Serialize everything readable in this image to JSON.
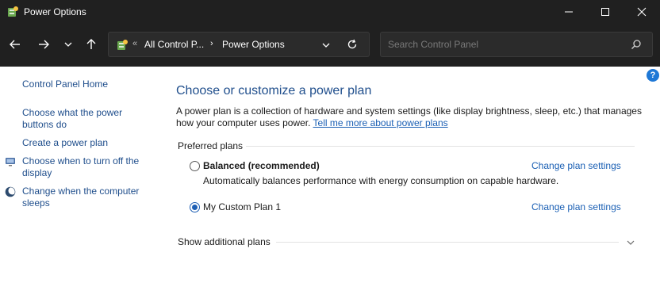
{
  "window": {
    "title": "Power Options",
    "minimize_icon": "minimize-icon",
    "maximize_icon": "maximize-icon",
    "close_icon": "close-icon"
  },
  "nav": {
    "address": {
      "overflow": "«",
      "crumbs": [
        "All Control P...",
        "Power Options"
      ],
      "separator": "›"
    },
    "search": {
      "placeholder": "Search Control Panel"
    }
  },
  "sidebar": {
    "items": [
      {
        "label": "Control Panel Home"
      },
      {
        "label": "Choose what the power buttons do"
      },
      {
        "label": "Create a power plan"
      },
      {
        "label": "Choose when to turn off the display",
        "icon": "display-icon"
      },
      {
        "label": "Change when the computer sleeps",
        "icon": "sleep-moon-icon"
      }
    ]
  },
  "main": {
    "help": "?",
    "title": "Choose or customize a power plan",
    "description": "A power plan is a collection of hardware and system settings (like display brightness, sleep, etc.) that manages how your computer uses power.",
    "description_link": "Tell me more about power plans",
    "preferred_label": "Preferred plans",
    "plans": [
      {
        "name": "Balanced (recommended)",
        "description": "Automatically balances performance with energy consumption on capable hardware.",
        "link": "Change plan settings",
        "selected": false
      },
      {
        "name": "My Custom Plan 1",
        "description": "",
        "link": "Change plan settings",
        "selected": true
      }
    ],
    "show_more_label": "Show additional plans"
  },
  "colors": {
    "titlebar": "#202020",
    "link": "#1a5fb4",
    "heading": "#1f4e8c",
    "radio_selected": "#1e5fb4"
  }
}
